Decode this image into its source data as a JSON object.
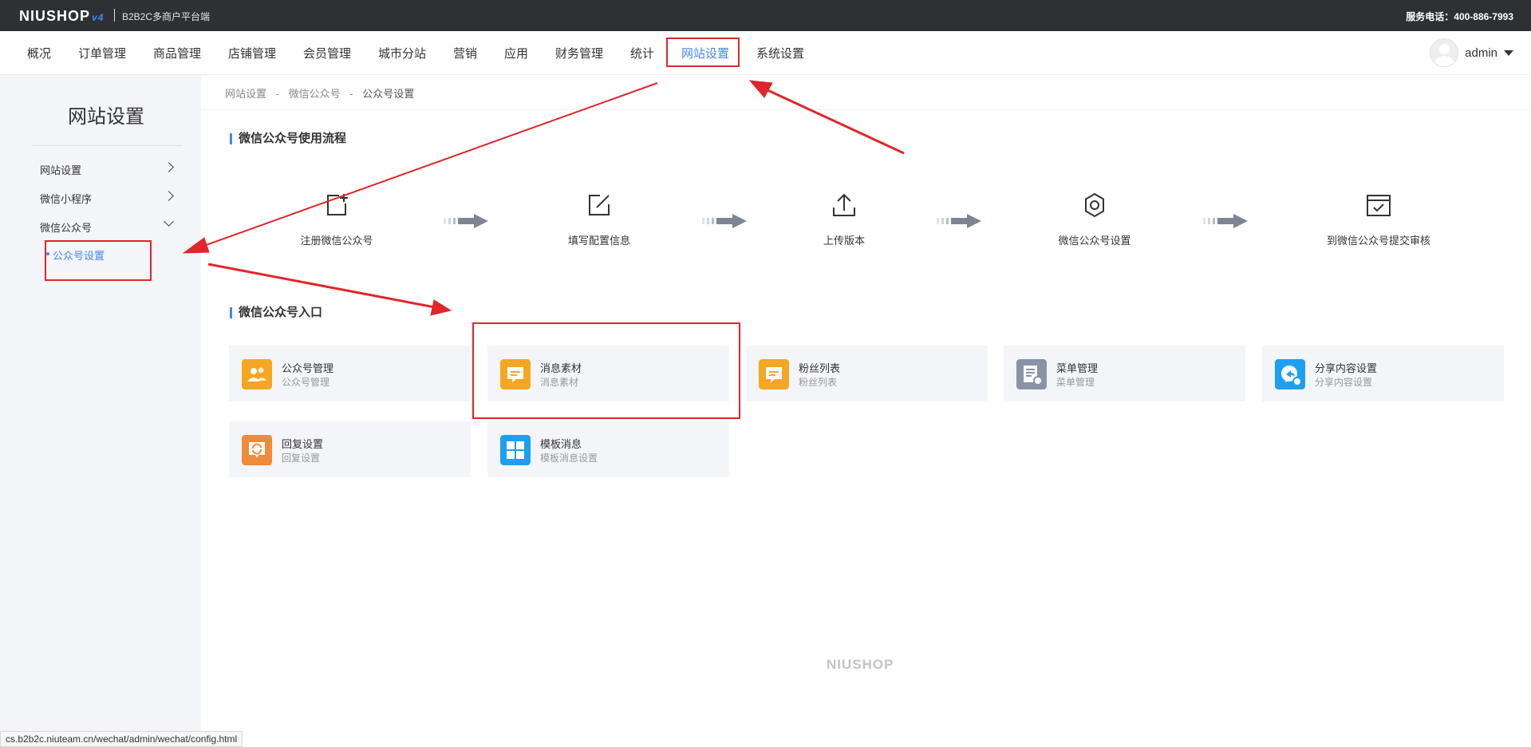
{
  "topbar": {
    "logo_text": "NIUSHOP",
    "logo_version": "v4",
    "platform": "B2B2C多商户平台端",
    "hotline": "服务电话：400-886-7993"
  },
  "nav": {
    "items": [
      "概况",
      "订单管理",
      "商品管理",
      "店铺管理",
      "会员管理",
      "城市分站",
      "营销",
      "应用",
      "财务管理",
      "统计",
      "网站设置",
      "系统设置"
    ],
    "active": "网站设置",
    "user": "admin"
  },
  "sidebar": {
    "title": "网站设置",
    "items": [
      "网站设置",
      "微信小程序",
      "微信公众号"
    ],
    "sub_item": "公众号设置"
  },
  "breadcrumb": [
    "网站设置",
    "-",
    "微信公众号",
    "-",
    "公众号设置"
  ],
  "flow": {
    "title": "微信公众号使用流程",
    "steps": [
      {
        "label": "注册微信公众号",
        "icon": "add-square-icon"
      },
      {
        "label": "填写配置信息",
        "icon": "edit-icon"
      },
      {
        "label": "上传版本",
        "icon": "upload-icon"
      },
      {
        "label": "微信公众号设置",
        "icon": "gear-icon"
      },
      {
        "label": "到微信公众号提交审核",
        "icon": "checklist-icon"
      }
    ]
  },
  "entry": {
    "title": "微信公众号入口",
    "cards": [
      {
        "name": "公众号管理",
        "desc": "公众号管理",
        "icon": "users-icon",
        "color": "#f5a623"
      },
      {
        "name": "消息素材",
        "desc": "消息素材",
        "icon": "message-icon",
        "color": "#f5a623"
      },
      {
        "name": "粉丝列表",
        "desc": "粉丝列表",
        "icon": "message-icon",
        "color": "#f5a623"
      },
      {
        "name": "菜单管理",
        "desc": "菜单管理",
        "icon": "menu-settings-icon",
        "color": "#8a93a6"
      },
      {
        "name": "分享内容设置",
        "desc": "分享内容设置",
        "icon": "share-icon",
        "color": "#1e9ff2"
      },
      {
        "name": "回复设置",
        "desc": "回复设置",
        "icon": "reply-icon",
        "color": "#f08a3c"
      },
      {
        "name": "模板消息",
        "desc": "模板消息设置",
        "icon": "template-icon",
        "color": "#1e9ff2"
      }
    ]
  },
  "footer_brand": "NIUSHOP",
  "status_url": "cs.b2b2c.niuteam.cn/wechat/admin/wechat/config.html",
  "colors": {
    "accent": "#3f86ff",
    "annotation": "#e0262b",
    "topbar": "#2f3033"
  }
}
